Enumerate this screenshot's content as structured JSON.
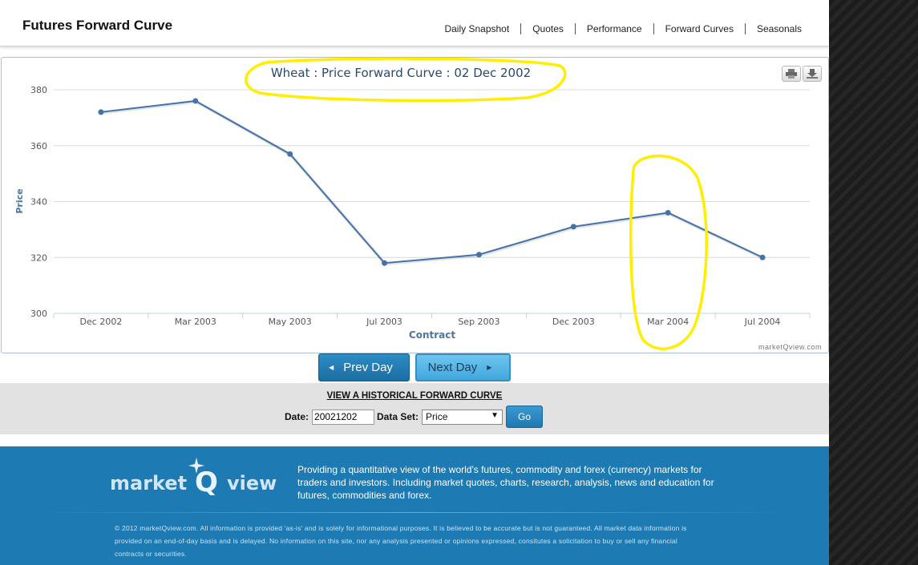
{
  "header": {
    "title": "Futures Forward Curve",
    "nav": [
      "Daily Snapshot",
      "Quotes",
      "Performance",
      "Forward Curves",
      "Seasonals"
    ]
  },
  "chart": {
    "credit": "marketQview.com",
    "print_icon": "print-icon",
    "download_icon": "download-icon"
  },
  "chart_data": {
    "type": "line",
    "title": "Wheat : Price Forward Curve : 02 Dec 2002",
    "xlabel": "Contract",
    "ylabel": "Price",
    "categories": [
      "Dec 2002",
      "Mar 2003",
      "May 2003",
      "Jul 2003",
      "Sep 2003",
      "Dec 2003",
      "Mar 2004",
      "Jul 2004"
    ],
    "values": [
      372,
      376,
      357,
      318,
      321,
      331,
      336,
      320
    ],
    "ylim": [
      300,
      380
    ],
    "yticks": [
      300,
      320,
      340,
      360,
      380
    ],
    "line_color": "#4572a7",
    "grid": true,
    "legend": "none"
  },
  "buttons": {
    "prev": "Prev Day",
    "next": "Next Day"
  },
  "historical": {
    "title": "VIEW A HISTORICAL FORWARD CURVE",
    "date_label": "Date:",
    "date_value": "20021202",
    "dataset_label": "Data Set:",
    "dataset_value": "Price",
    "go": "Go"
  },
  "footer": {
    "description": "Providing a quantitative view of the world's futures, commodity and forex (currency) markets for traders and investors. Including market quotes, charts, research, analysis, news and education for futures, commodities and forex.",
    "legal": "© 2012 marketQview.com. All information is provided 'as-is' and is solely for informational purposes. It is believed to be accurate but is not guaranteed. All market data information is provided on an end-of-day basis and is delayed. No information on this site, nor any analysis presented or opinions expressed, consitutes a solicitation to buy or sell any financial contracts or securities.",
    "logo_text_left": "market",
    "logo_text_mid": "Q",
    "logo_text_right": "view"
  },
  "colors": {
    "accent": "#1d7ab2",
    "annotation": "#ffee00"
  }
}
